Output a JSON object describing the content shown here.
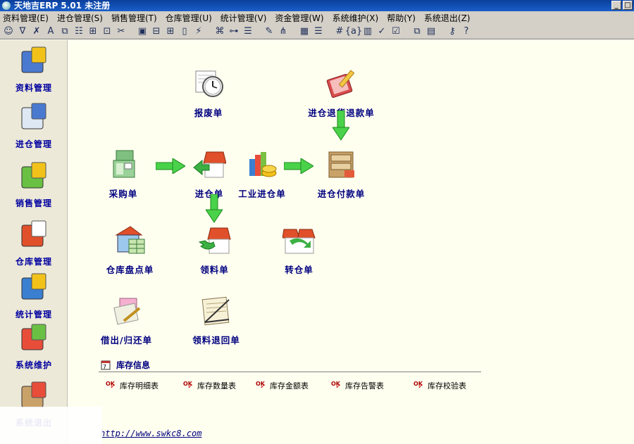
{
  "window": {
    "title": "天地吉ERP 5.01 未注册"
  },
  "menu": [
    "资料管理(E)",
    "进仓管理(S)",
    "销售管理(T)",
    "仓库管理(U)",
    "统计管理(V)",
    "资金管理(W)",
    "系统维护(X)",
    "帮助(Y)",
    "系统退出(Z)"
  ],
  "toolbar_icons": [
    [
      "smile-icon",
      "☺"
    ],
    [
      "sort-icon",
      "∇"
    ],
    [
      "delete-table-icon",
      "✗"
    ],
    [
      "font-icon",
      "A"
    ],
    [
      "copy-icon",
      "⧉"
    ],
    [
      "list-icon",
      "☷"
    ],
    [
      "filter-icon",
      "⊞"
    ],
    [
      "crop-icon",
      "⊡"
    ],
    [
      "tools-icon",
      "✂"
    ],
    [
      "bus-icon",
      "▣"
    ],
    [
      "grid-icon",
      "⊟"
    ],
    [
      "tree-icon",
      "⊞"
    ],
    [
      "page-icon",
      "▯"
    ],
    [
      "lightning-icon",
      "⚡"
    ],
    [
      "network-icon",
      "⌘"
    ],
    [
      "hierarchy-icon",
      "⊶"
    ],
    [
      "server-icon",
      "☰"
    ],
    [
      "chart-edit-icon",
      "✎"
    ],
    [
      "org-chart-icon",
      "⋔"
    ],
    [
      "report-icon",
      "▦"
    ],
    [
      "document-icon",
      "☰"
    ],
    [
      "hash-icon",
      "#"
    ],
    [
      "variable-icon",
      "{a}"
    ],
    [
      "bar-chart-icon",
      "▥"
    ],
    [
      "check-edit-icon",
      "✓"
    ],
    [
      "checkbox-icon",
      "☑"
    ],
    [
      "copy-pages-icon",
      "⧉"
    ],
    [
      "notes-icon",
      "▤"
    ],
    [
      "key-icon",
      "⚷"
    ],
    [
      "help-icon",
      "?"
    ]
  ],
  "sidebar": [
    {
      "label": "资料管理",
      "icon": "book-edit-icon"
    },
    {
      "label": "进仓管理",
      "icon": "person-form-icon"
    },
    {
      "label": "销售管理",
      "icon": "sales-chart-icon"
    },
    {
      "label": "仓库管理",
      "icon": "warehouse-house-icon"
    },
    {
      "label": "统计管理",
      "icon": "stats-chart-icon"
    },
    {
      "label": "系统维护",
      "icon": "system-tools-icon"
    },
    {
      "label": "系统退出",
      "icon": "exit-door-icon"
    }
  ],
  "nodes": {
    "scrap": "报废单",
    "inbound_return": "进仓退货退款单",
    "purchase": "采购单",
    "inbound": "进仓单",
    "industrial_inbound": "工业进仓单",
    "inbound_payment": "进仓付款单",
    "stocktake": "仓库盘点单",
    "requisition": "领料单",
    "transfer": "转仓单",
    "lend_return": "借出/归还单",
    "requisition_return": "领料退回单"
  },
  "inventory": {
    "title": "库存信息",
    "reports": [
      "库存明细表",
      "库存数量表",
      "库存金额表",
      "库存告警表",
      "库存校验表"
    ]
  },
  "footer": {
    "url": "http://www.swkc8.com"
  },
  "colors": {
    "label_blue": "#000080",
    "arrow_green": "#4ad24a",
    "background": "#fffff0"
  }
}
